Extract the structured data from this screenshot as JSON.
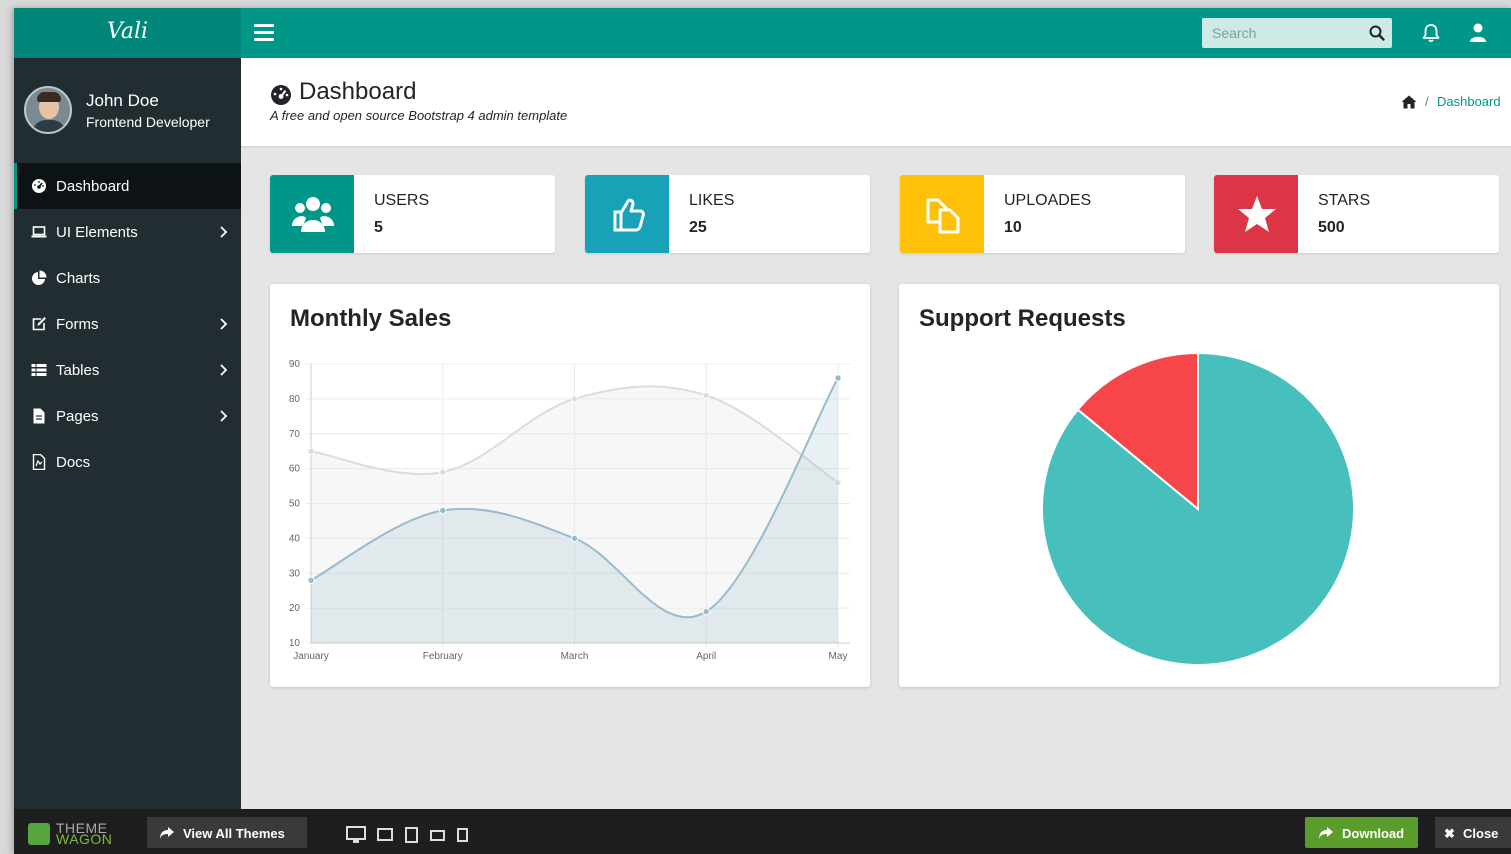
{
  "app": {
    "logo": "Vali"
  },
  "header": {
    "search_placeholder": "Search",
    "icons": [
      "menu-icon",
      "search-icon",
      "bell-icon",
      "user-icon"
    ]
  },
  "profile": {
    "name": "John Doe",
    "role": "Frontend Developer"
  },
  "sidebar": {
    "items": [
      {
        "label": "Dashboard",
        "icon": "dashboard-icon",
        "active": true,
        "has_children": false
      },
      {
        "label": "UI Elements",
        "icon": "laptop-icon",
        "active": false,
        "has_children": true
      },
      {
        "label": "Charts",
        "icon": "pie-chart-icon",
        "active": false,
        "has_children": false
      },
      {
        "label": "Forms",
        "icon": "edit-icon",
        "active": false,
        "has_children": true
      },
      {
        "label": "Tables",
        "icon": "table-icon",
        "active": false,
        "has_children": true
      },
      {
        "label": "Pages",
        "icon": "file-icon",
        "active": false,
        "has_children": true
      },
      {
        "label": "Docs",
        "icon": "docs-icon",
        "active": false,
        "has_children": false
      }
    ]
  },
  "page": {
    "title": "Dashboard",
    "subtitle": "A free and open source Bootstrap 4 admin template",
    "breadcrumb": {
      "sep": "/",
      "current": "Dashboard"
    }
  },
  "widgets": [
    {
      "label": "USERS",
      "value": "5",
      "color": "#009688",
      "icon": "users-icon"
    },
    {
      "label": "LIKES",
      "value": "25",
      "color": "#17a2b8",
      "icon": "thumbs-up-icon"
    },
    {
      "label": "UPLOADES",
      "value": "10",
      "color": "#ffc107",
      "icon": "files-icon"
    },
    {
      "label": "STARS",
      "value": "500",
      "color": "#dc3545",
      "icon": "star-icon"
    }
  ],
  "charts": {
    "sales_title": "Monthly Sales",
    "support_title": "Support Requests"
  },
  "chart_data": [
    {
      "type": "line",
      "title": "Monthly Sales",
      "categories": [
        "January",
        "February",
        "March",
        "April",
        "May"
      ],
      "series": [
        {
          "values": [
            65,
            59,
            80,
            81,
            56
          ],
          "color": "#dcdcdc"
        },
        {
          "values": [
            28,
            48,
            40,
            19,
            86
          ],
          "color": "#97bbcd"
        }
      ],
      "ylim": [
        10,
        90
      ],
      "yticks": [
        10,
        20,
        30,
        40,
        50,
        60,
        70,
        80,
        90
      ],
      "grid": true,
      "fill": "area"
    },
    {
      "type": "pie",
      "title": "Support Requests",
      "slices": [
        {
          "value": 86,
          "color": "#46BFBD"
        },
        {
          "value": 14,
          "color": "#F7464A"
        }
      ]
    }
  ],
  "footer": {
    "brand_top": "THEME",
    "brand_bottom": "WAGON",
    "view_all": "View All Themes",
    "download": "Download",
    "close": "Close",
    "x": "✖"
  }
}
